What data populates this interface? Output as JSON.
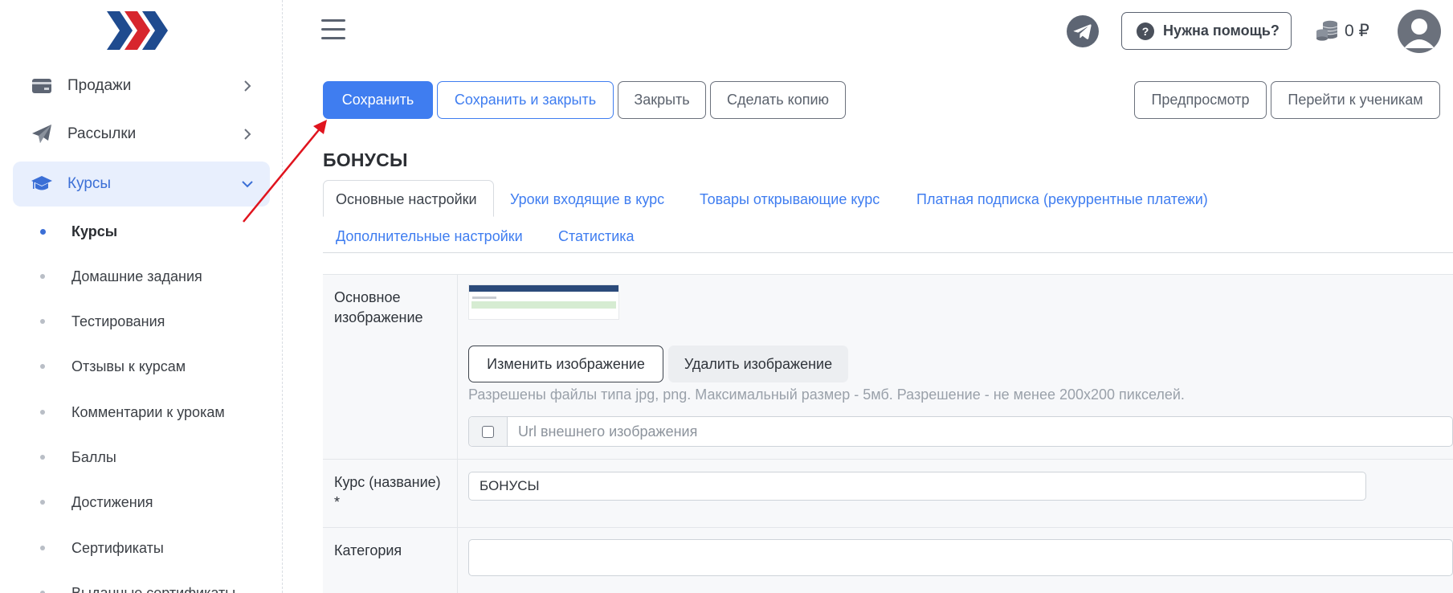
{
  "sidebar": {
    "menu": [
      {
        "label": "Продажи",
        "icon": "credit-card-icon"
      },
      {
        "label": "Рассылки",
        "icon": "paper-plane-icon"
      },
      {
        "label": "Курсы",
        "icon": "graduation-cap-icon"
      }
    ],
    "submenu": [
      {
        "label": "Курсы",
        "active": true
      },
      {
        "label": "Домашние задания"
      },
      {
        "label": "Тестирования"
      },
      {
        "label": "Отзывы к курсам"
      },
      {
        "label": "Комментарии к урокам"
      },
      {
        "label": "Баллы"
      },
      {
        "label": "Достижения"
      },
      {
        "label": "Сертификаты"
      },
      {
        "label": "Выданные сертификаты"
      }
    ]
  },
  "header": {
    "help_label": "Нужна помощь?",
    "help_icon_text": "?",
    "balance": "0 ₽"
  },
  "toolbar": {
    "save": "Сохранить",
    "save_close": "Сохранить и закрыть",
    "close": "Закрыть",
    "copy": "Сделать копию",
    "preview": "Предпросмотр",
    "students": "Перейти к ученикам"
  },
  "page_title": "БОНУСЫ",
  "tabs": [
    "Основные настройки",
    "Уроки входящие в курс",
    "Товары открывающие курс",
    "Платная подписка (рекуррентные платежи)",
    "Дополнительные настройки",
    "Статистика"
  ],
  "form": {
    "image_label": "Основное изображение",
    "change_image": "Изменить изображение",
    "delete_image": "Удалить изображение",
    "image_hint": "Разрешены файлы типа jpg, png. Максимальный размер - 5мб. Разрешение - не менее 200x200 пикселей.",
    "url_placeholder": "Url внешнего изображения",
    "course_label": "Курс (название) *",
    "course_value": "БОНУСЫ",
    "category_label": "Категория",
    "category_value": ""
  },
  "colors": {
    "primary": "#3f7df0",
    "active_menu_bg": "#e8effd",
    "annotation_arrow": "#e0141e"
  }
}
